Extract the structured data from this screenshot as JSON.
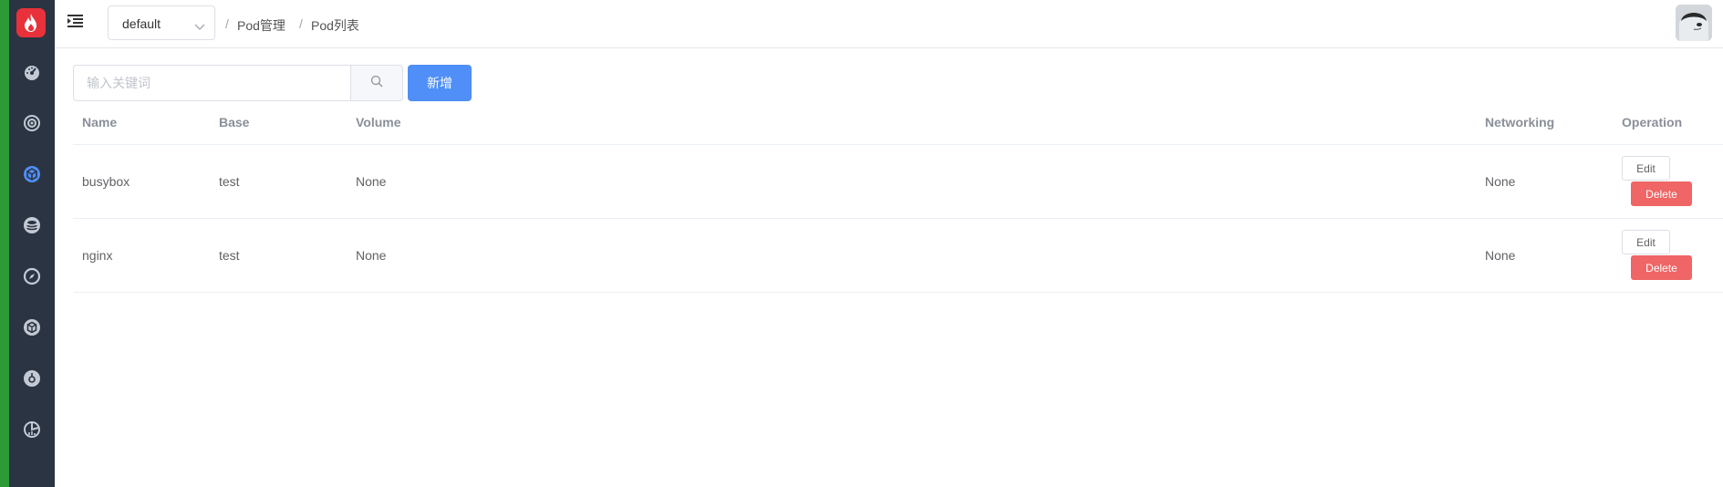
{
  "theme": {
    "sidebar_bg": "#2b3442",
    "accent": "#4f8ff7",
    "danger": "#f06565",
    "logo_bg": "#e8313a",
    "active_icon": "#4f8ff7"
  },
  "sidebar": {
    "logo": "flame-logo",
    "items": [
      {
        "icon": "dashboard-gauge-icon",
        "active": false
      },
      {
        "icon": "cluster-gear-icon",
        "active": false
      },
      {
        "icon": "cube-icon",
        "active": true
      },
      {
        "icon": "database-icon",
        "active": false
      },
      {
        "icon": "compass-icon",
        "active": false
      },
      {
        "icon": "package-icon",
        "active": false
      },
      {
        "icon": "helm-icon",
        "active": false
      },
      {
        "icon": "chart-icon",
        "active": false
      }
    ]
  },
  "header": {
    "namespace": "default",
    "breadcrumb": [
      "Pod管理",
      "Pod列表"
    ],
    "breadcrumb_sep": "/"
  },
  "toolbar": {
    "search_placeholder": "输入关键词",
    "add_label": "新增"
  },
  "table": {
    "columns": [
      "Name",
      "Base",
      "Volume",
      "Networking",
      "Operation"
    ],
    "rows": [
      {
        "name": "busybox",
        "base": "test",
        "volume": "None",
        "networking": "None",
        "edit": "Edit",
        "delete": "Delete"
      },
      {
        "name": "nginx",
        "base": "test",
        "volume": "None",
        "networking": "None",
        "edit": "Edit",
        "delete": "Delete"
      }
    ]
  }
}
